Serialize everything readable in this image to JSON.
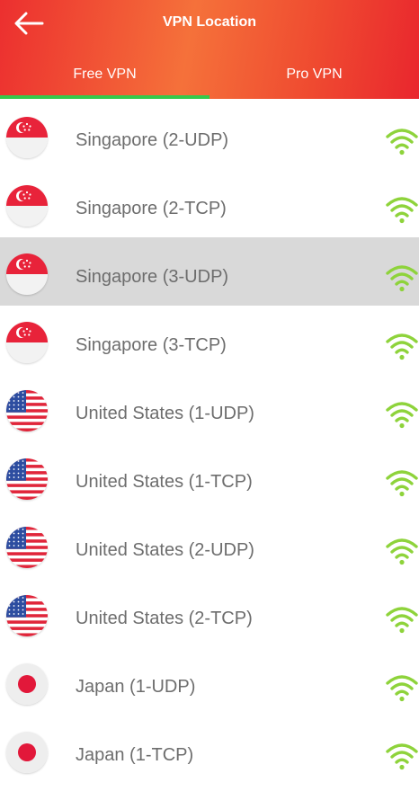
{
  "header": {
    "title": "VPN Location"
  },
  "tabs": [
    {
      "label": "Free VPN",
      "active": true
    },
    {
      "label": "Pro VPN",
      "active": false
    }
  ],
  "servers": [
    {
      "name": "Singapore (2-UDP)",
      "flag": "singapore-flag-icon"
    },
    {
      "name": "Singapore (2-TCP)",
      "flag": "singapore-flag-icon"
    },
    {
      "name": "Singapore (3-UDP)",
      "flag": "singapore-flag-icon",
      "selected": true
    },
    {
      "name": "Singapore (3-TCP)",
      "flag": "singapore-flag-icon"
    },
    {
      "name": "United States (1-UDP)",
      "flag": "us-flag-icon"
    },
    {
      "name": "United States (1-TCP)",
      "flag": "us-flag-icon"
    },
    {
      "name": "United States (2-UDP)",
      "flag": "us-flag-icon"
    },
    {
      "name": "United States (2-TCP)",
      "flag": "us-flag-icon"
    },
    {
      "name": "Japan (1-UDP)",
      "flag": "japan-flag-icon"
    },
    {
      "name": "Japan (1-TCP)",
      "flag": "japan-flag-icon"
    }
  ],
  "colors": {
    "header_red": "#ec2f2f",
    "header_orange": "#f5713a",
    "tab_indicator": "#35c94b",
    "signal_green": "#8ed33b",
    "selected_row": "#d9d9d9"
  }
}
